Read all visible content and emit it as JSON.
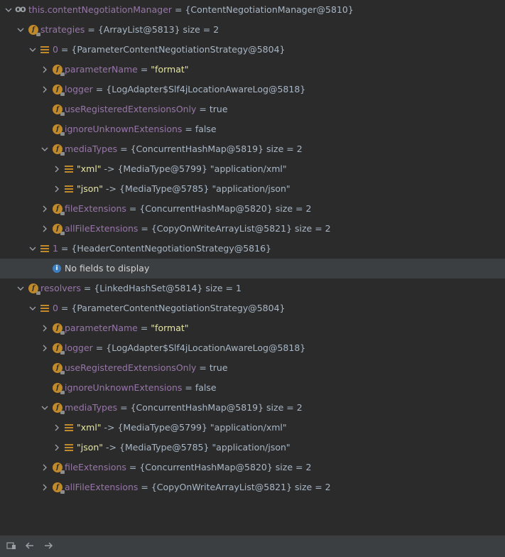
{
  "root": {
    "label": "this.contentNegotiationManager",
    "value": "= {ContentNegotiationManager@5810}"
  },
  "tree": [
    {
      "depth": 1,
      "arrow": "down",
      "icon": "field",
      "name": "strategies",
      "rest": " = {ArrayList@5813}  size = 2"
    },
    {
      "depth": 2,
      "arrow": "down",
      "icon": "array",
      "name": "0",
      "rest": " = {ParameterContentNegotiationStrategy@5804}"
    },
    {
      "depth": 3,
      "arrow": "right",
      "icon": "field",
      "name": "parameterName",
      "rest": " = ",
      "str": "\"format\""
    },
    {
      "depth": 3,
      "arrow": "right",
      "icon": "field",
      "name": "logger",
      "rest": " = {LogAdapter$Slf4jLocationAwareLog@5818}"
    },
    {
      "depth": 3,
      "arrow": "none",
      "icon": "field",
      "name": "useRegisteredExtensionsOnly",
      "rest": " = true"
    },
    {
      "depth": 3,
      "arrow": "none",
      "icon": "field",
      "name": "ignoreUnknownExtensions",
      "rest": " = false"
    },
    {
      "depth": 3,
      "arrow": "down",
      "icon": "field",
      "name": "mediaTypes",
      "rest": " = {ConcurrentHashMap@5819}  size = 2"
    },
    {
      "depth": 4,
      "arrow": "right",
      "icon": "array",
      "str": "\"xml\"",
      "rest": " -> {MediaType@5799} \"application/xml\""
    },
    {
      "depth": 4,
      "arrow": "right",
      "icon": "array",
      "str": "\"json\"",
      "rest": " -> {MediaType@5785} \"application/json\""
    },
    {
      "depth": 3,
      "arrow": "right",
      "icon": "field",
      "name": "fileExtensions",
      "rest": " = {ConcurrentHashMap@5820}  size = 2"
    },
    {
      "depth": 3,
      "arrow": "right",
      "icon": "field",
      "name": "allFileExtensions",
      "rest": " = {CopyOnWriteArrayList@5821}  size = 2"
    },
    {
      "depth": 2,
      "arrow": "down",
      "icon": "array",
      "name": "1",
      "rest": " = {HeaderContentNegotiationStrategy@5816}"
    },
    {
      "depth": 3,
      "arrow": "none",
      "icon": "info",
      "msg": "No fields to display",
      "selected": true
    },
    {
      "depth": 1,
      "arrow": "down",
      "icon": "field",
      "name": "resolvers",
      "rest": " = {LinkedHashSet@5814}  size = 1"
    },
    {
      "depth": 2,
      "arrow": "down",
      "icon": "array",
      "name": "0",
      "rest": " = {ParameterContentNegotiationStrategy@5804}"
    },
    {
      "depth": 3,
      "arrow": "right",
      "icon": "field",
      "name": "parameterName",
      "rest": " = ",
      "str": "\"format\""
    },
    {
      "depth": 3,
      "arrow": "right",
      "icon": "field",
      "name": "logger",
      "rest": " = {LogAdapter$Slf4jLocationAwareLog@5818}"
    },
    {
      "depth": 3,
      "arrow": "none",
      "icon": "field",
      "name": "useRegisteredExtensionsOnly",
      "rest": " = true"
    },
    {
      "depth": 3,
      "arrow": "none",
      "icon": "field",
      "name": "ignoreUnknownExtensions",
      "rest": " = false"
    },
    {
      "depth": 3,
      "arrow": "down",
      "icon": "field",
      "name": "mediaTypes",
      "rest": " = {ConcurrentHashMap@5819}  size = 2"
    },
    {
      "depth": 4,
      "arrow": "right",
      "icon": "array",
      "str": "\"xml\"",
      "rest": " -> {MediaType@5799} \"application/xml\""
    },
    {
      "depth": 4,
      "arrow": "right",
      "icon": "array",
      "str": "\"json\"",
      "rest": " -> {MediaType@5785} \"application/json\""
    },
    {
      "depth": 3,
      "arrow": "right",
      "icon": "field",
      "name": "fileExtensions",
      "rest": " = {ConcurrentHashMap@5820}  size = 2"
    },
    {
      "depth": 3,
      "arrow": "right",
      "icon": "field",
      "name": "allFileExtensions",
      "rest": " = {CopyOnWriteArrayList@5821}  size = 2"
    }
  ],
  "statusbar": {
    "icons": [
      "restore-layout-icon",
      "arrow-left-icon",
      "arrow-right-icon"
    ]
  },
  "colors": {
    "background": "#2b2b2b",
    "field_name": "#9876aa",
    "string": "#e6e6a3",
    "text": "#a9b7c6",
    "field_icon": "#c08a2a",
    "selection": "#3c3f41"
  }
}
